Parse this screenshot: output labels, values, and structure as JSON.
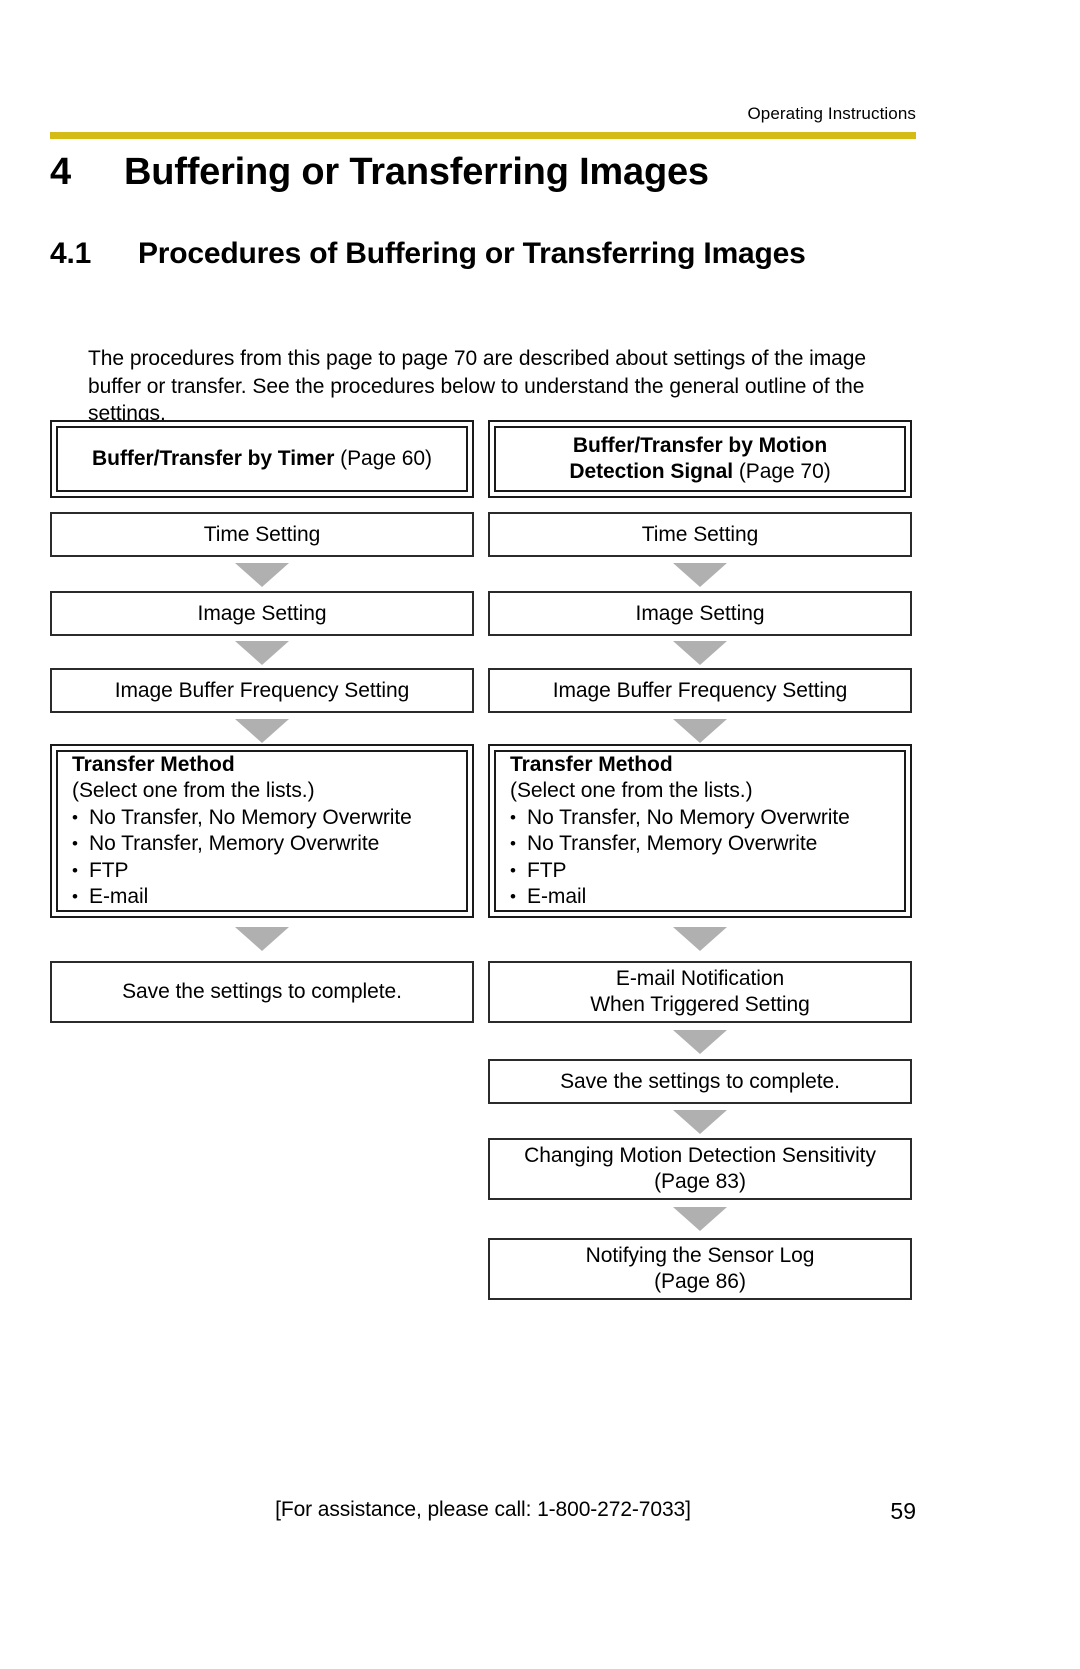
{
  "header": {
    "label": "Operating Instructions",
    "rule_color": "#d5bb15"
  },
  "chapter": {
    "number": "4",
    "title": "Buffering or Transferring Images"
  },
  "section": {
    "number": "4.1",
    "title": "Procedures of Buffering or Transferring Images"
  },
  "intro": "The procedures from this page to page 70 are described about settings of the image buffer or transfer. See the procedures below to understand the general outline of the settings.",
  "flow": {
    "arrow_color": "#b0b0b0",
    "left": {
      "start_bold": "Buffer/Transfer by Timer",
      "start_page": " (Page 60)",
      "steps": [
        "Time Setting",
        "Image Setting",
        "Image Buffer Frequency Setting"
      ],
      "transfer_method": {
        "heading": "Transfer Method",
        "subtitle": "(Select one from the lists.)",
        "options": [
          "No Transfer, No Memory Overwrite",
          "No Transfer, Memory Overwrite",
          "FTP",
          "E-mail"
        ]
      },
      "end": "Save the settings to complete."
    },
    "right": {
      "start_bold_line1": "Buffer/Transfer by Motion",
      "start_bold_line2": "Detection Signal",
      "start_page": " (Page 70)",
      "steps": [
        "Time Setting",
        "Image Setting",
        "Image Buffer Frequency Setting"
      ],
      "transfer_method": {
        "heading": "Transfer Method",
        "subtitle": "(Select one from the lists.)",
        "options": [
          "No Transfer, No Memory Overwrite",
          "No Transfer, Memory Overwrite",
          "FTP",
          "E-mail"
        ]
      },
      "email_notification_line1": "E-mail Notification",
      "email_notification_line2": "When Triggered Setting",
      "save": "Save the settings to complete.",
      "sensitivity_line1": "Changing Motion Detection Sensitivity",
      "sensitivity_line2": "(Page 83)",
      "sensor_log_line1": "Notifying the Sensor Log",
      "sensor_log_line2": "(Page 86)"
    }
  },
  "footer": {
    "assistance": "[For assistance, please call: 1-800-272-7033]",
    "page_number": "59"
  }
}
